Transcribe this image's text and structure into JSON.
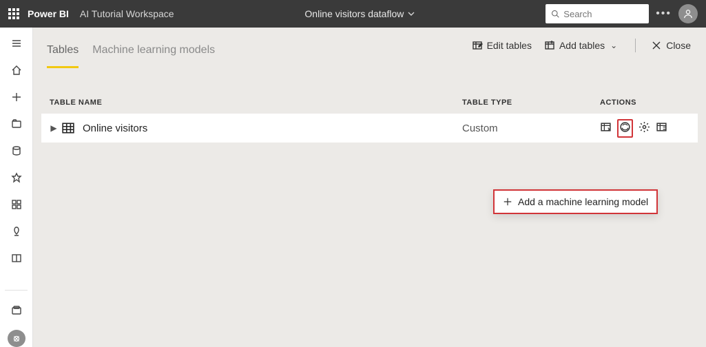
{
  "header": {
    "app": "Power BI",
    "workspace": "AI Tutorial Workspace",
    "dataflow": "Online visitors dataflow",
    "search_placeholder": "Search"
  },
  "actions": {
    "edit": "Edit tables",
    "add": "Add tables",
    "close": "Close"
  },
  "tabs": {
    "tables": "Tables",
    "ml": "Machine learning models"
  },
  "columns": {
    "name": "Table Name",
    "type": "Table Type",
    "actions": "Actions"
  },
  "rows": [
    {
      "name": "Online visitors",
      "type": "Custom"
    }
  ],
  "callout": {
    "label": "Add a machine learning model"
  }
}
